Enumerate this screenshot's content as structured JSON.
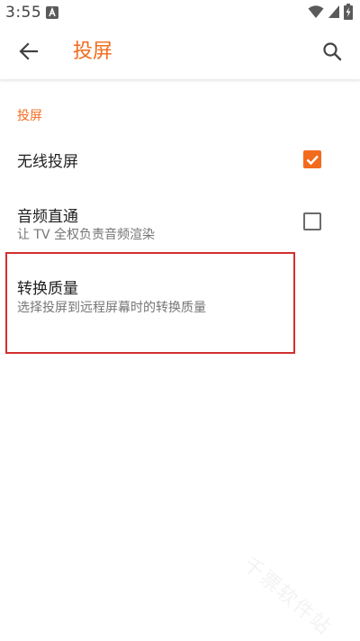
{
  "status_bar": {
    "time": "3:55"
  },
  "app_bar": {
    "title": "投屏"
  },
  "section": {
    "header": "投屏"
  },
  "preferences": [
    {
      "title": "无线投屏",
      "summary": "",
      "checked": true
    },
    {
      "title": "音频直通",
      "summary": "让 TV 全权负责音频渲染",
      "checked": false
    },
    {
      "title": "转换质量",
      "summary": "选择投屏到远程屏幕时的转换质量"
    }
  ],
  "colors": {
    "accent": "#f26b1d",
    "highlight_border": "#d32f2f"
  },
  "icons": {
    "back": "arrow-back-icon",
    "search": "search-icon",
    "wifi": "wifi-icon",
    "signal": "signal-icon",
    "battery": "battery-charging-icon",
    "app_notification": "app-notification-icon"
  },
  "watermark": "千票软件站"
}
